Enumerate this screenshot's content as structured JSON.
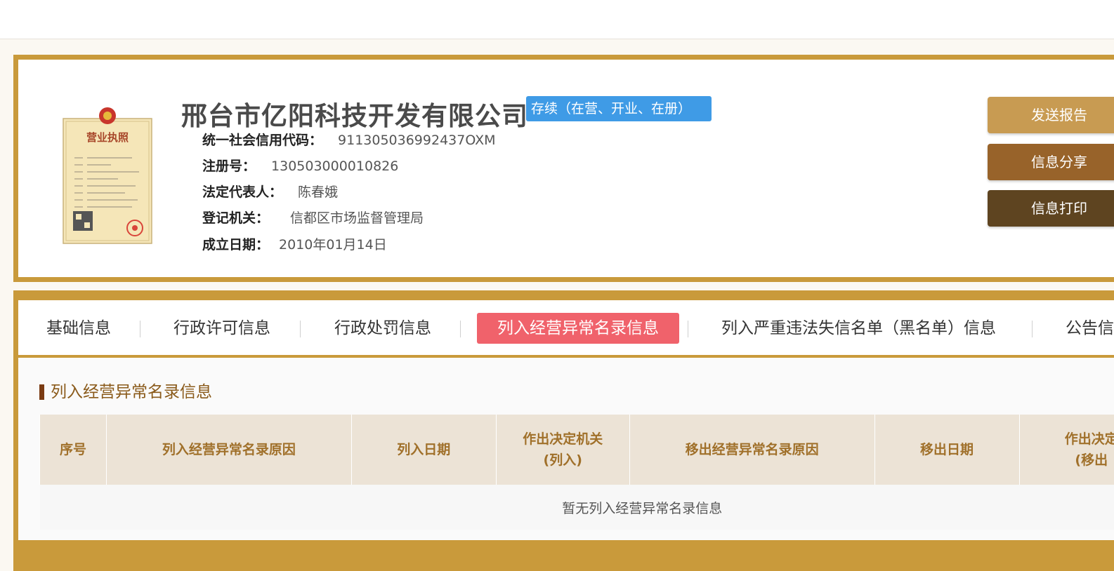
{
  "company": {
    "name": "邢台市亿阳科技开发有限公司",
    "status": "存续（在营、开业、在册）",
    "fields": [
      {
        "label": "统一社会信用代码：",
        "value": "911305036992437OXM"
      },
      {
        "label": "注册号：",
        "value": "130503000010826"
      },
      {
        "label": "法定代表人：",
        "value": "陈春娥"
      },
      {
        "label": "登记机关：",
        "value": "信都区市场监督管理局"
      },
      {
        "label": "成立日期：",
        "value": "2010年01月14日"
      }
    ],
    "license_image_text": "营业执照"
  },
  "actions": {
    "send_report": "发送报告",
    "share": "信息分享",
    "print": "信息打印"
  },
  "tabs": [
    {
      "label": "基础信息"
    },
    {
      "label": "行政许可信息"
    },
    {
      "label": "行政处罚信息"
    },
    {
      "label": "列入经营异常名录信息"
    },
    {
      "label": "列入严重违法失信名单（黑名单）信息"
    },
    {
      "label": "公告信"
    }
  ],
  "section": {
    "title": "列入经营异常名录信息",
    "columns": [
      "序号",
      "列入经营异常名录原因",
      "列入日期",
      "作出决定机关（列入）",
      "移出经营异常名录原因",
      "移出日期",
      "作出决定（移出"
    ],
    "empty_text": "暂无列入经营异常名录信息"
  },
  "colors": {
    "gold": "#c99a3b",
    "status_blue": "#3f9be6",
    "active_tab": "#f0626b",
    "btn_send": "#c89b52",
    "btn_share": "#98632a",
    "btn_print": "#5e4420"
  }
}
